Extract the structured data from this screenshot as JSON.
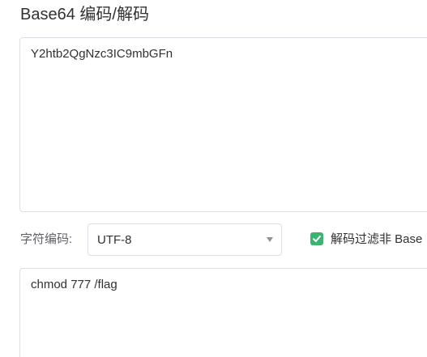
{
  "header": {
    "title": "Base64 编码/解码"
  },
  "input": {
    "value": "Y2htb2QgNzc3IC9mbGFn"
  },
  "options": {
    "charset_label": "字符编码:",
    "charset_value": "UTF-8",
    "filter_checked": true,
    "filter_label": "解码过滤非 Base",
    "accent_color": "#3cb371"
  },
  "output": {
    "value": "chmod 777 /flag"
  },
  "icons": {
    "dropdown": "chevron-down-icon",
    "check": "check-icon"
  }
}
